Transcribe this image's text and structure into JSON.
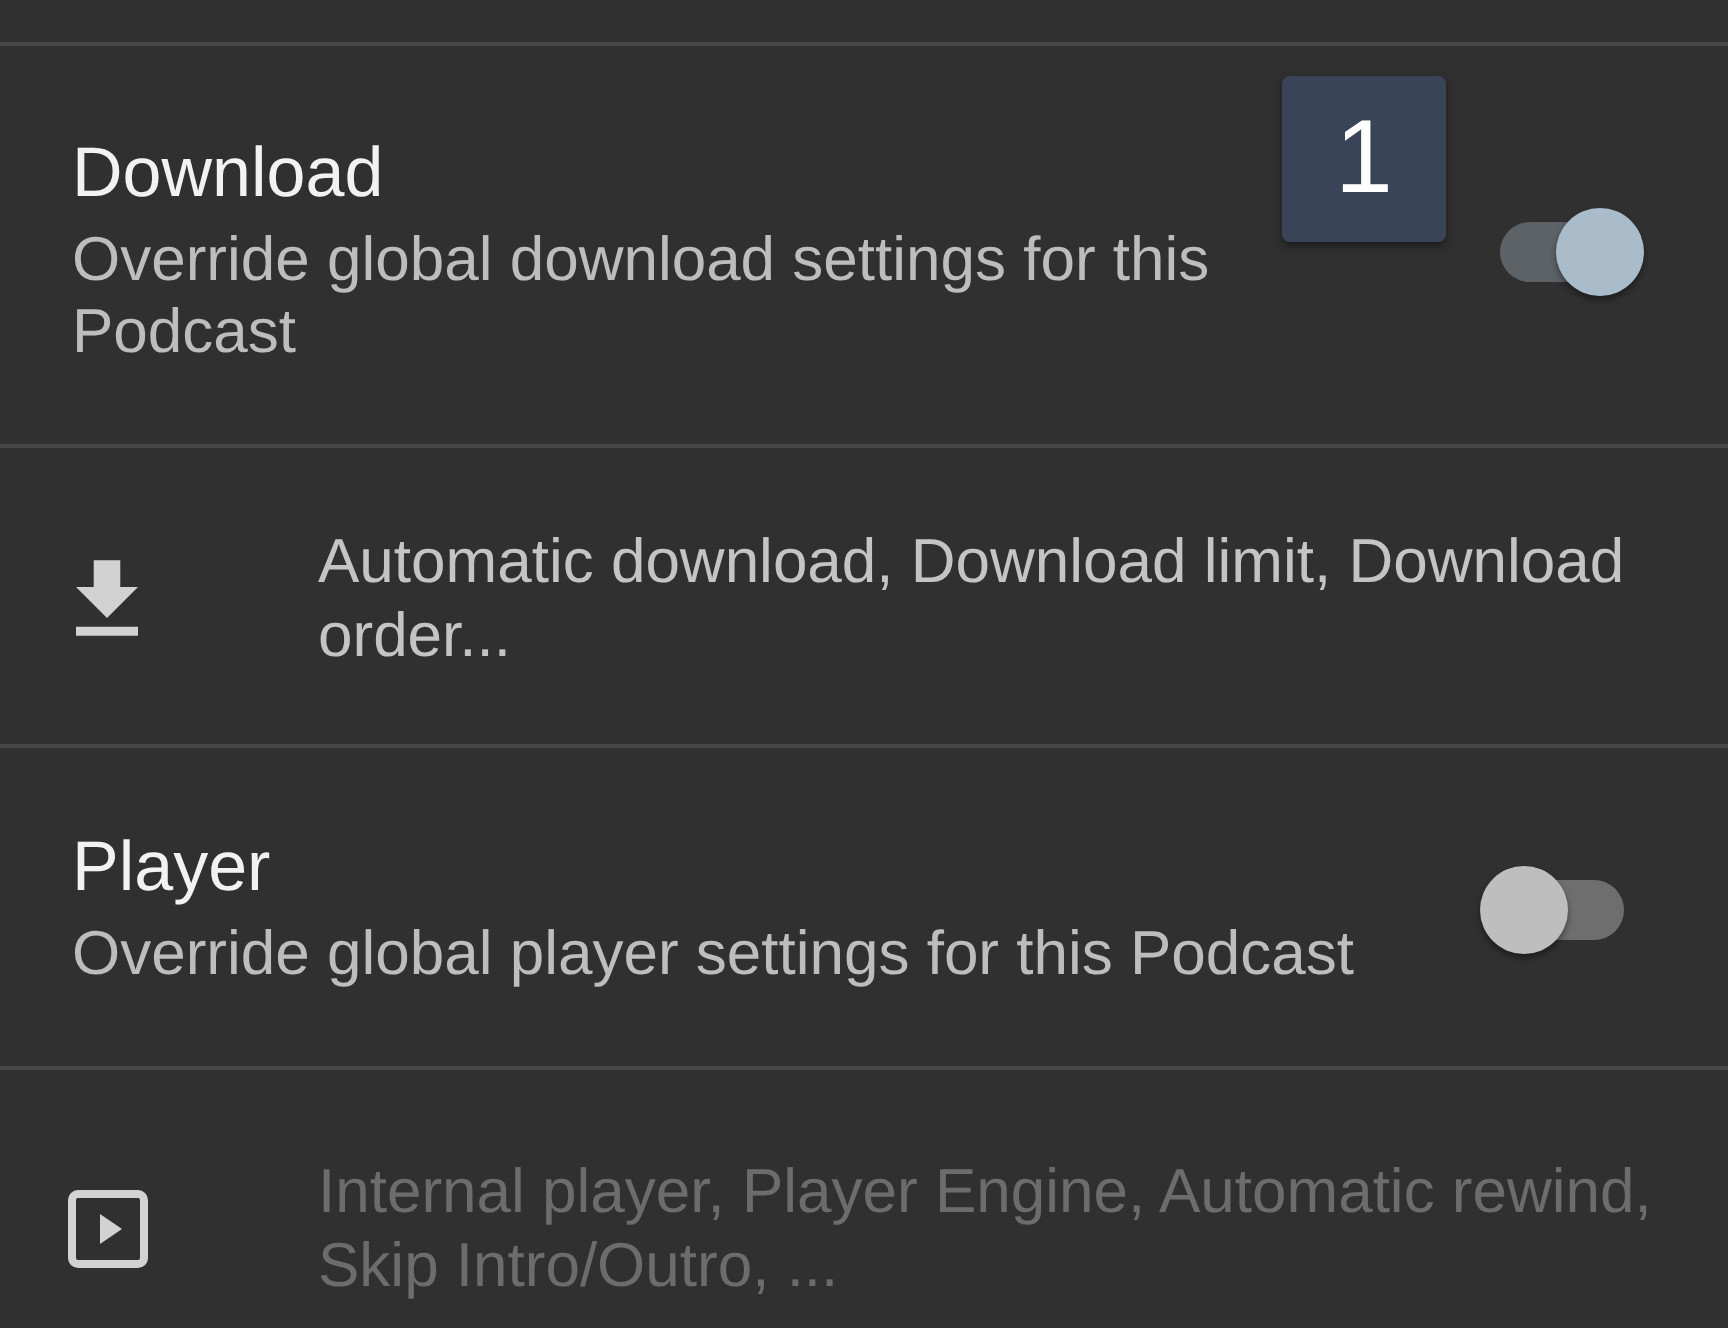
{
  "badge": "1",
  "sections": [
    {
      "title": "Download",
      "subtitle": "Override global download settings for this Podcast",
      "on": true,
      "details": {
        "text": "Automatic download, Download limit, Download order...",
        "disabled": false
      }
    },
    {
      "title": "Player",
      "subtitle": "Override global player settings for this Podcast",
      "on": false,
      "details": {
        "text": "Internal player, Player Engine, Automatic rewind, Skip Intro/Outro, ...",
        "disabled": true
      }
    }
  ]
}
